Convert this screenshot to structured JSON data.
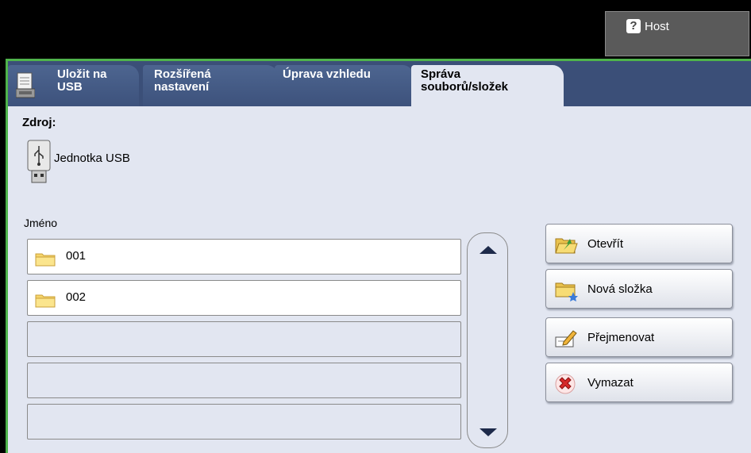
{
  "header": {
    "host_label": "Host",
    "help_icon": "question-mark-icon"
  },
  "tabs": [
    {
      "label": "Uložit na\nUSB",
      "active": false
    },
    {
      "label": "Rozšířená\nnastavení",
      "active": false
    },
    {
      "label": "Úprava vzhledu",
      "active": false
    },
    {
      "label": "Správa\nsouborů/složek",
      "active": true
    }
  ],
  "source": {
    "heading": "Zdroj:",
    "device_label": "Jednotka USB",
    "icon": "usb-drive-icon"
  },
  "list": {
    "header": "Jméno",
    "rows": [
      "001",
      "002",
      "",
      "",
      ""
    ]
  },
  "actions": {
    "open": "Otevřít",
    "new_folder": "Nová složka",
    "rename": "Přejmenovat",
    "delete": "Vymazat"
  },
  "colors": {
    "accent_green": "#4fb34b",
    "tab_bar": "#3b4f78",
    "panel": "#e2e6f1"
  }
}
